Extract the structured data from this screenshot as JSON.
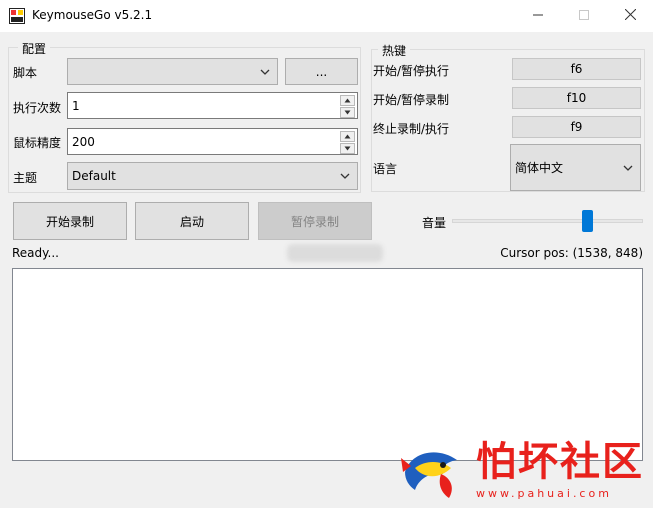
{
  "window": {
    "title": "KeymouseGo v5.2.1"
  },
  "config": {
    "group_title": "配置",
    "script_label": "脚本",
    "script_value": "",
    "browse_label": "...",
    "run_times_label": "执行次数",
    "run_times_value": "1",
    "precision_label": "鼠标精度",
    "precision_value": "200",
    "theme_label": "主题",
    "theme_value": "Default"
  },
  "hotkeys": {
    "group_title": "热键",
    "items": [
      {
        "label": "开始/暂停执行",
        "key": "f6"
      },
      {
        "label": "开始/暂停录制",
        "key": "f10"
      },
      {
        "label": "终止录制/执行",
        "key": "f9"
      }
    ],
    "language_label": "语言",
    "language_value": "简体中文"
  },
  "actions": {
    "record_label": "开始录制",
    "start_label": "启动",
    "pause_label": "暂停录制"
  },
  "volume": {
    "label": "音量",
    "level_fraction": 0.72
  },
  "status": {
    "text": "Ready...",
    "cursor_pos": "Cursor pos: (1538, 848)"
  },
  "log": {
    "content": ""
  },
  "watermark": {
    "brand": "怕坏社区",
    "url": "www.pahuai.com"
  },
  "colors": {
    "accent": "#0078d7",
    "watermark_red": "#e8211c"
  }
}
